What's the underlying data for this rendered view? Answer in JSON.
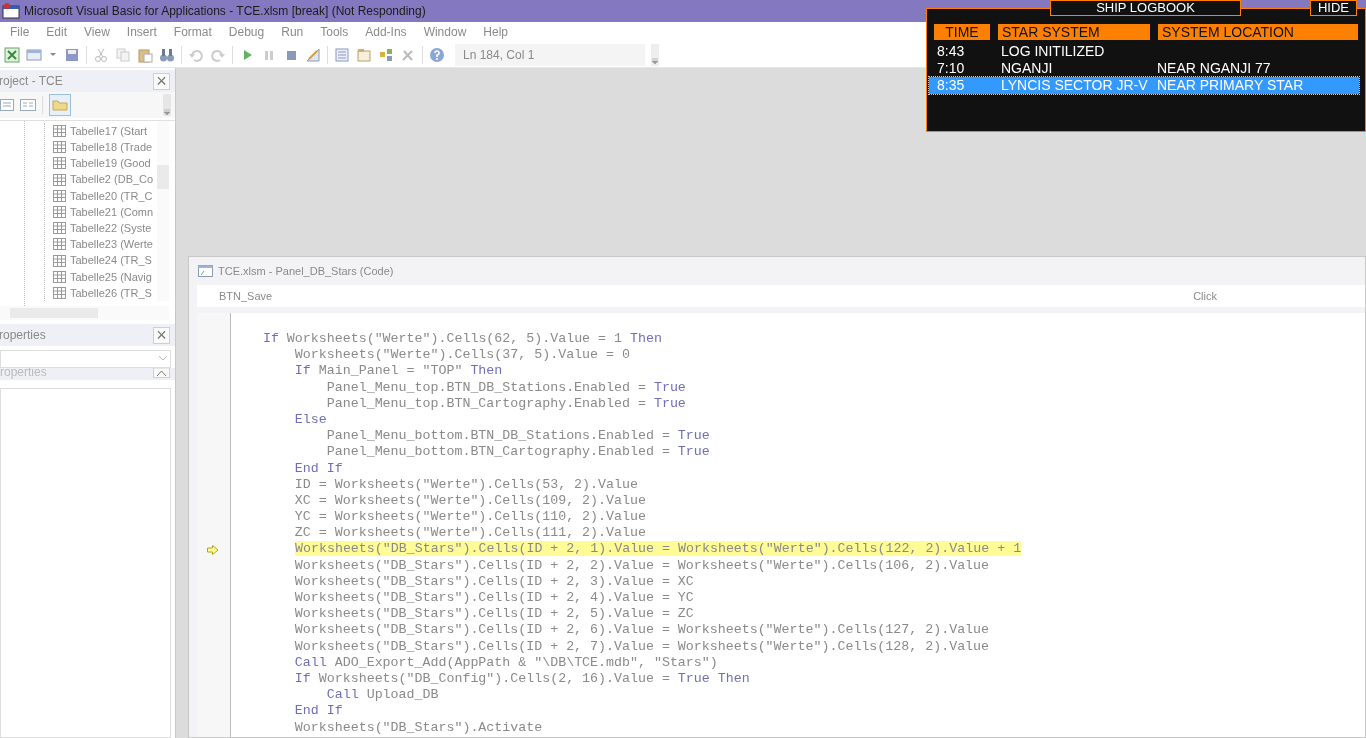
{
  "window": {
    "title": "Microsoft Visual Basic for Applications - TCE.xlsm [break] (Not Responding)"
  },
  "menu": [
    "File",
    "Edit",
    "View",
    "Insert",
    "Format",
    "Debug",
    "Run",
    "Tools",
    "Add-Ins",
    "Window",
    "Help"
  ],
  "toolbar": {
    "position": "Ln 184, Col 1"
  },
  "project_pane": {
    "title": "roject - TCE",
    "close": "×",
    "items": [
      "Tabelle17 (Start",
      "Tabelle18 (Trade",
      "Tabelle19 (Good",
      "Tabelle2 (DB_Co",
      "Tabelle20 (TR_C",
      "Tabelle21 (Comn",
      "Tabelle22 (Syste",
      "Tabelle23 (Werte",
      "Tabelle24 (TR_S",
      "Tabelle25 (Navig",
      "Tabelle26 (TR_S"
    ]
  },
  "properties_pane": {
    "title": "roperties",
    "close": "×",
    "subtitle": "roperties"
  },
  "code_window": {
    "title": "TCE.xlsm - Panel_DB_Stars (Code)",
    "object": "BTN_Save",
    "procedure": "Click",
    "lines": [
      {
        "current": false,
        "segments": [
          {
            "kind": "keyword",
            "text": "    If"
          },
          {
            "kind": "plain",
            "text": " Worksheets(\"Werte\").Cells(62, 5).Value = 1 "
          },
          {
            "kind": "keyword",
            "text": "Then"
          }
        ]
      },
      {
        "current": false,
        "segments": [
          {
            "kind": "plain",
            "text": "        Worksheets(\"Werte\").Cells(37, 5).Value = 0"
          }
        ]
      },
      {
        "current": false,
        "segments": [
          {
            "kind": "keyword",
            "text": "        If"
          },
          {
            "kind": "plain",
            "text": " Main_Panel = \"TOP\" "
          },
          {
            "kind": "keyword",
            "text": "Then"
          }
        ]
      },
      {
        "current": false,
        "segments": [
          {
            "kind": "plain",
            "text": "            Panel_Menu_top.BTN_DB_Stations.Enabled = "
          },
          {
            "kind": "keyword",
            "text": "True"
          }
        ]
      },
      {
        "current": false,
        "segments": [
          {
            "kind": "plain",
            "text": "            Panel_Menu_top.BTN_Cartography.Enabled = "
          },
          {
            "kind": "keyword",
            "text": "True"
          }
        ]
      },
      {
        "current": false,
        "segments": [
          {
            "kind": "keyword",
            "text": "        Else"
          }
        ]
      },
      {
        "current": false,
        "segments": [
          {
            "kind": "plain",
            "text": "            Panel_Menu_bottom.BTN_DB_Stations.Enabled = "
          },
          {
            "kind": "keyword",
            "text": "True"
          }
        ]
      },
      {
        "current": false,
        "segments": [
          {
            "kind": "plain",
            "text": "            Panel_Menu_bottom.BTN_Cartography.Enabled = "
          },
          {
            "kind": "keyword",
            "text": "True"
          }
        ]
      },
      {
        "current": false,
        "segments": [
          {
            "kind": "keyword",
            "text": "        End If"
          }
        ]
      },
      {
        "current": false,
        "segments": [
          {
            "kind": "plain",
            "text": "        ID = Worksheets(\"Werte\").Cells(53, 2).Value"
          }
        ]
      },
      {
        "current": false,
        "segments": [
          {
            "kind": "plain",
            "text": "        XC = Worksheets(\"Werte\").Cells(109, 2).Value"
          }
        ]
      },
      {
        "current": false,
        "segments": [
          {
            "kind": "plain",
            "text": "        YC = Worksheets(\"Werte\").Cells(110, 2).Value"
          }
        ]
      },
      {
        "current": false,
        "segments": [
          {
            "kind": "plain",
            "text": "        ZC = Worksheets(\"Werte\").Cells(111, 2).Value"
          }
        ]
      },
      {
        "current": true,
        "segments": [
          {
            "kind": "plain",
            "text": "Worksheets(\"DB_Stars\").Cells(ID + 2, 1).Value = Worksheets(\"Werte\").Cells(122, 2).Value + 1"
          }
        ]
      },
      {
        "current": false,
        "segments": [
          {
            "kind": "plain",
            "text": "        Worksheets(\"DB_Stars\").Cells(ID + 2, 2).Value = Worksheets(\"Werte\").Cells(106, 2).Value"
          }
        ]
      },
      {
        "current": false,
        "segments": [
          {
            "kind": "plain",
            "text": "        Worksheets(\"DB_Stars\").Cells(ID + 2, 3).Value = XC"
          }
        ]
      },
      {
        "current": false,
        "segments": [
          {
            "kind": "plain",
            "text": "        Worksheets(\"DB_Stars\").Cells(ID + 2, 4).Value = YC"
          }
        ]
      },
      {
        "current": false,
        "segments": [
          {
            "kind": "plain",
            "text": "        Worksheets(\"DB_Stars\").Cells(ID + 2, 5).Value = ZC"
          }
        ]
      },
      {
        "current": false,
        "segments": [
          {
            "kind": "plain",
            "text": "        Worksheets(\"DB_Stars\").Cells(ID + 2, 6).Value = Worksheets(\"Werte\").Cells(127, 2).Value"
          }
        ]
      },
      {
        "current": false,
        "segments": [
          {
            "kind": "plain",
            "text": "        Worksheets(\"DB_Stars\").Cells(ID + 2, 7).Value = Worksheets(\"Werte\").Cells(128, 2).Value"
          }
        ]
      },
      {
        "current": false,
        "segments": [
          {
            "kind": "keyword",
            "text": "        Call"
          },
          {
            "kind": "plain",
            "text": " ADO_Export_Add(AppPath & \"\\DB\\TCE.mdb\", \"Stars\")"
          }
        ]
      },
      {
        "current": false,
        "segments": [
          {
            "kind": "keyword",
            "text": "        If"
          },
          {
            "kind": "plain",
            "text": " Worksheets(\"DB_Config\").Cells(2, 16).Value = "
          },
          {
            "kind": "keyword",
            "text": "True Then"
          }
        ]
      },
      {
        "current": false,
        "segments": [
          {
            "kind": "keyword",
            "text": "            Call"
          },
          {
            "kind": "plain",
            "text": " Upload_DB"
          }
        ]
      },
      {
        "current": false,
        "segments": [
          {
            "kind": "keyword",
            "text": "        End If"
          }
        ]
      },
      {
        "current": false,
        "segments": [
          {
            "kind": "plain",
            "text": "        Worksheets(\"DB_Stars\").Activate"
          }
        ]
      }
    ]
  },
  "logbook": {
    "title": "SHIP LOGBOOK",
    "hide": "HIDE",
    "columns": [
      "TIME",
      "STAR SYSTEM",
      "SYSTEM LOCATION"
    ],
    "rows": [
      {
        "time": "8:43",
        "system": "LOG INITILIZED",
        "selected": false
      },
      {
        "time": "7:10",
        "system": "NGANJI",
        "location": "NEAR NGANJI 77",
        "selected": false
      },
      {
        "time": "8:35",
        "system": "LYNCIS SECTOR JR-V",
        "location": "NEAR PRIMARY STAR",
        "selected": true
      }
    ]
  }
}
